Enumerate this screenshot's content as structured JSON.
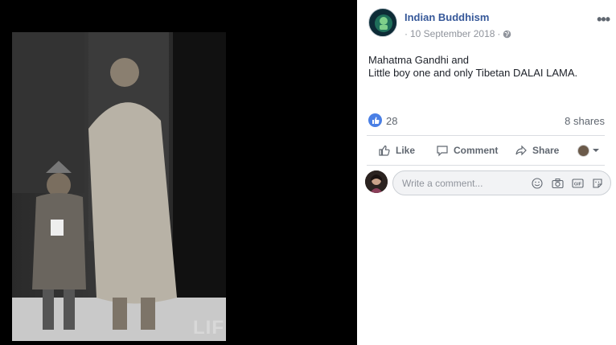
{
  "photo": {
    "watermark": "LIF"
  },
  "post": {
    "page_name": "Indian Buddhism",
    "date": "10 September 2018",
    "separator": "·",
    "text_lines": [
      "Mahatma Gandhi and",
      "Little boy one and only Tibetan DALAI LAMA."
    ]
  },
  "stats": {
    "like_count": "28",
    "shares": "8 shares"
  },
  "actions": {
    "like": "Like",
    "comment": "Comment",
    "share": "Share"
  },
  "comment_box": {
    "placeholder": "Write a comment..."
  },
  "colors": {
    "link": "#365899",
    "like_blue": "#4a7fe5",
    "muted": "#90949c",
    "action_gray": "#606770"
  }
}
